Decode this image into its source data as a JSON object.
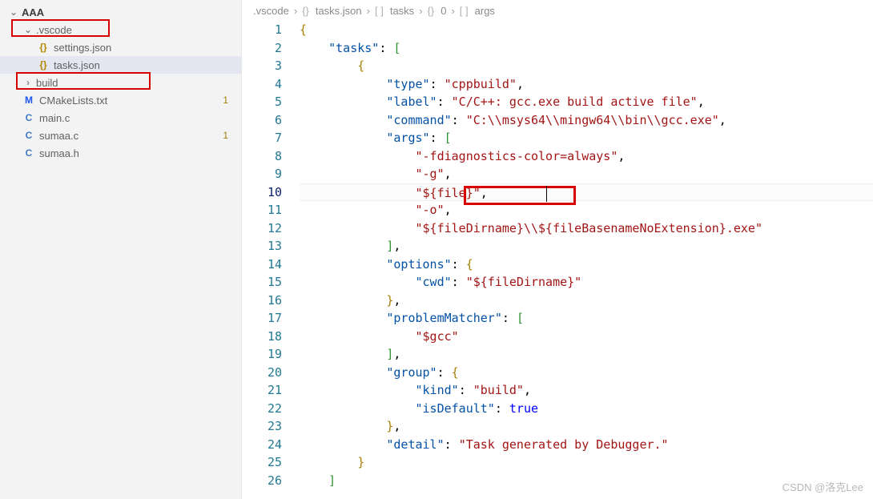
{
  "sidebar": {
    "root": "AAA",
    "items": [
      {
        "chev": "⌄",
        "icon": "",
        "label": ".vscode",
        "bold": false
      },
      {
        "chev": "",
        "icon": "{}",
        "iconCls": "braces",
        "label": "settings.json"
      },
      {
        "chev": "",
        "icon": "{}",
        "iconCls": "braces",
        "label": "tasks.json",
        "selected": true
      },
      {
        "chev": "›",
        "icon": "",
        "label": "build"
      },
      {
        "chev": "",
        "icon": "M",
        "iconCls": "M",
        "label": "CMakeLists.txt",
        "count": "1"
      },
      {
        "chev": "",
        "icon": "C",
        "iconCls": "C",
        "label": "main.c"
      },
      {
        "chev": "",
        "icon": "C",
        "iconCls": "C",
        "label": "sumaa.c",
        "count": "1"
      },
      {
        "chev": "",
        "icon": "C",
        "iconCls": "C",
        "label": "sumaa.h"
      }
    ]
  },
  "breadcrumbs": {
    "parts": [
      {
        "icon": "",
        "text": ".vscode"
      },
      {
        "icon": "{}",
        "text": "tasks.json"
      },
      {
        "icon": "[ ]",
        "text": "tasks"
      },
      {
        "icon": "{}",
        "text": "0"
      },
      {
        "icon": "[ ]",
        "text": "args"
      }
    ]
  },
  "code": {
    "lines": [
      "1",
      "2",
      "3",
      "4",
      "5",
      "6",
      "7",
      "8",
      "9",
      "10",
      "11",
      "12",
      "13",
      "14",
      "15",
      "16",
      "17",
      "18",
      "19",
      "20",
      "21",
      "22",
      "23",
      "24",
      "25",
      "26"
    ],
    "current_line": "10",
    "keys": {
      "tasks": "\"tasks\"",
      "type": "\"type\"",
      "label": "\"label\"",
      "command": "\"command\"",
      "args": "\"args\"",
      "options": "\"options\"",
      "cwd": "\"cwd\"",
      "problemMatcher": "\"problemMatcher\"",
      "group": "\"group\"",
      "kind": "\"kind\"",
      "isDefault": "\"isDefault\"",
      "detail": "\"detail\""
    },
    "vals": {
      "cppbuild": "\"cppbuild\"",
      "labelV": "\"C/C++: gcc.exe build active file\"",
      "commandV": "\"C:\\\\msys64\\\\mingw64\\\\bin\\\\gcc.exe\"",
      "arg1": "\"-fdiagnostics-color=always\"",
      "arg2": "\"-g\"",
      "arg3": "\"${file}\"",
      "arg4": "\"-o\"",
      "arg5": "\"${fileDirname}\\\\${fileBasenameNoExtension}.exe\"",
      "cwdV": "\"${fileDirname}\"",
      "gcc": "\"$gcc\"",
      "build": "\"build\"",
      "true": "true",
      "detailV": "\"Task generated by Debugger.\""
    }
  },
  "watermark": "CSDN @洛克Lee"
}
